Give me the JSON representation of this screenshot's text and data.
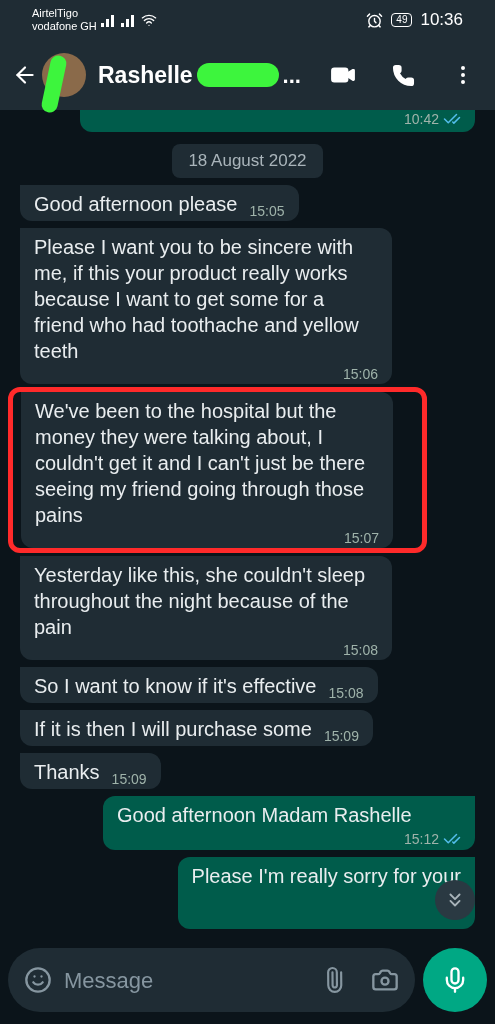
{
  "status_bar": {
    "carriers": [
      "AirtelTigo",
      "vodafone GH"
    ],
    "battery": "49",
    "time": "10:36"
  },
  "header": {
    "name": "Rashelle",
    "redacted": true,
    "ellipsis": "..."
  },
  "top_partial": {
    "time": "10:42",
    "read": true
  },
  "date_chip": "18 August 2022",
  "messages": [
    {
      "kind": "incoming",
      "text": "Good afternoon please",
      "time": "15:05",
      "highlighted": false
    },
    {
      "kind": "incoming",
      "text": "Please I want you to be sincere with me, if this your product really works because I want to get some for a friend who had toothache and yellow teeth",
      "time": "15:06",
      "highlighted": false
    },
    {
      "kind": "incoming",
      "text": "We've been to the hospital but the money they were talking about, I couldn't get it and I can't just be there seeing my friend going through those pains",
      "time": "15:07",
      "highlighted": true
    },
    {
      "kind": "incoming",
      "text": "Yesterday like this, she couldn't sleep throughout the night because of the pain",
      "time": "15:08",
      "highlighted": false
    },
    {
      "kind": "incoming",
      "text": "So I want to know if it's effective",
      "time": "15:08",
      "highlighted": false
    },
    {
      "kind": "incoming",
      "text": "If it is then I will purchase some",
      "time": "15:09",
      "highlighted": false
    },
    {
      "kind": "incoming",
      "text": "Thanks",
      "time": "15:09",
      "highlighted": false
    },
    {
      "kind": "outgoing",
      "text": "Good afternoon Madam Rashelle",
      "time": "15:12",
      "read": true,
      "highlighted": false
    },
    {
      "kind": "outgoing",
      "text": "Please I'm really sorry for your",
      "highlighted": false
    }
  ],
  "composer": {
    "placeholder": "Message"
  }
}
